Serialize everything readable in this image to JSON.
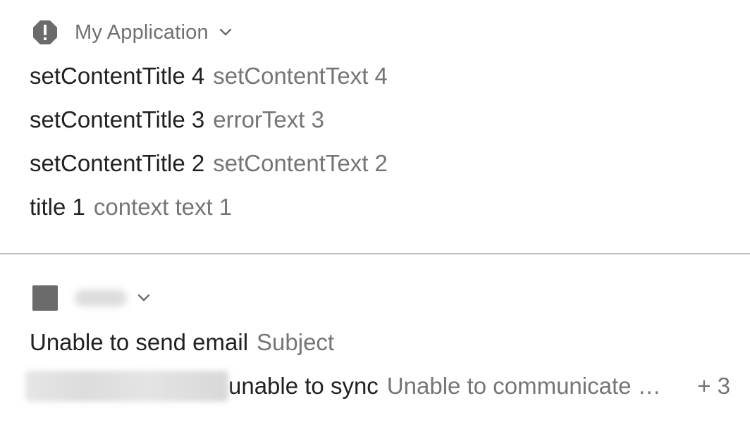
{
  "group1": {
    "app_name": "My Application",
    "app_icon": "alert-octagon-icon",
    "expand_icon": "chevron-down-icon",
    "notifications": [
      {
        "title": "setContentTitle 4",
        "text": "setContentText 4"
      },
      {
        "title": "setContentTitle 3",
        "text": "errorText 3"
      },
      {
        "title": "setContentTitle 2",
        "text": "setContentText 2"
      },
      {
        "title": "title 1",
        "text": "context text 1"
      }
    ]
  },
  "group2": {
    "app_icon": "square-app-icon",
    "expand_icon": "chevron-down-icon",
    "notifications": [
      {
        "title": "Unable to send email",
        "text": "Subject"
      },
      {
        "title": "unable to sync",
        "text": "Unable to communicate with server",
        "more_count": "+ 3"
      }
    ]
  },
  "colors": {
    "title": "#212121",
    "secondary": "#757575",
    "icon": "#6b6b6b",
    "divider": "#bdbdbd",
    "background": "#ffffff"
  }
}
